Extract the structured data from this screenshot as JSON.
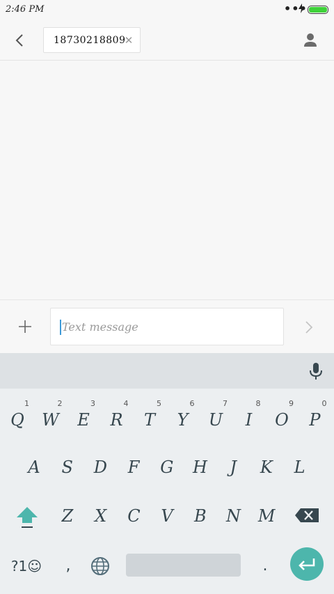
{
  "status_bar": {
    "time": "2:46 PM",
    "dots": "•••",
    "charging_icon": "bolt-icon",
    "battery_color": "#3fd23a"
  },
  "header": {
    "back_icon": "chevron-left-icon",
    "recipient_number": "18730218809",
    "chip_remove_icon": "close-icon",
    "contact_icon": "person-icon"
  },
  "composer": {
    "attach_icon": "plus-icon",
    "placeholder": "Text message",
    "send_icon": "chevron-right-icon"
  },
  "keyboard": {
    "mic_icon": "mic-icon",
    "row1": [
      {
        "letter": "Q",
        "hint": "1"
      },
      {
        "letter": "W",
        "hint": "2"
      },
      {
        "letter": "E",
        "hint": "3"
      },
      {
        "letter": "R",
        "hint": "4"
      },
      {
        "letter": "T",
        "hint": "5"
      },
      {
        "letter": "Y",
        "hint": "6"
      },
      {
        "letter": "U",
        "hint": "7"
      },
      {
        "letter": "I",
        "hint": "8"
      },
      {
        "letter": "O",
        "hint": "9"
      },
      {
        "letter": "P",
        "hint": "0"
      }
    ],
    "row2": [
      "A",
      "S",
      "D",
      "F",
      "G",
      "H",
      "J",
      "K",
      "L"
    ],
    "row3": [
      "Z",
      "X",
      "C",
      "V",
      "B",
      "N",
      "M"
    ],
    "symbols_label": "?1☺",
    "comma_label": ",",
    "period_label": ".",
    "accent_color": "#4db6ac"
  }
}
